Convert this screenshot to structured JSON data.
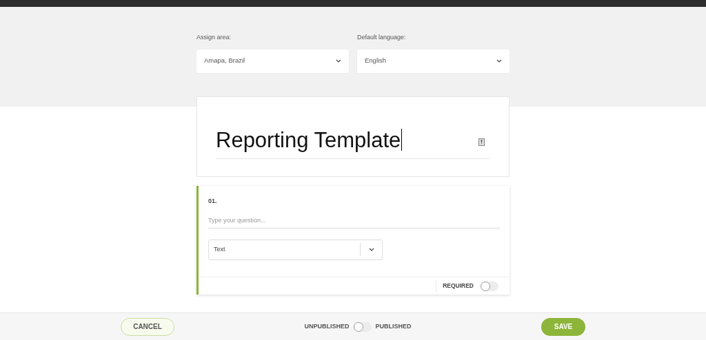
{
  "assign_area": {
    "label": "Assign area:",
    "value": "Amapa, Brazil"
  },
  "default_language": {
    "label": "Default language:",
    "value": "English"
  },
  "template": {
    "title": "Reporting Template"
  },
  "questions": [
    {
      "number": "01.",
      "placeholder": "Type your question...",
      "type": "Text",
      "required_label": "REQUIRED",
      "required": false
    }
  ],
  "footer": {
    "cancel": "CANCEL",
    "unpublished": "UNPUBLISHED",
    "published": "PUBLISHED",
    "on": false,
    "save": "SAVE"
  }
}
